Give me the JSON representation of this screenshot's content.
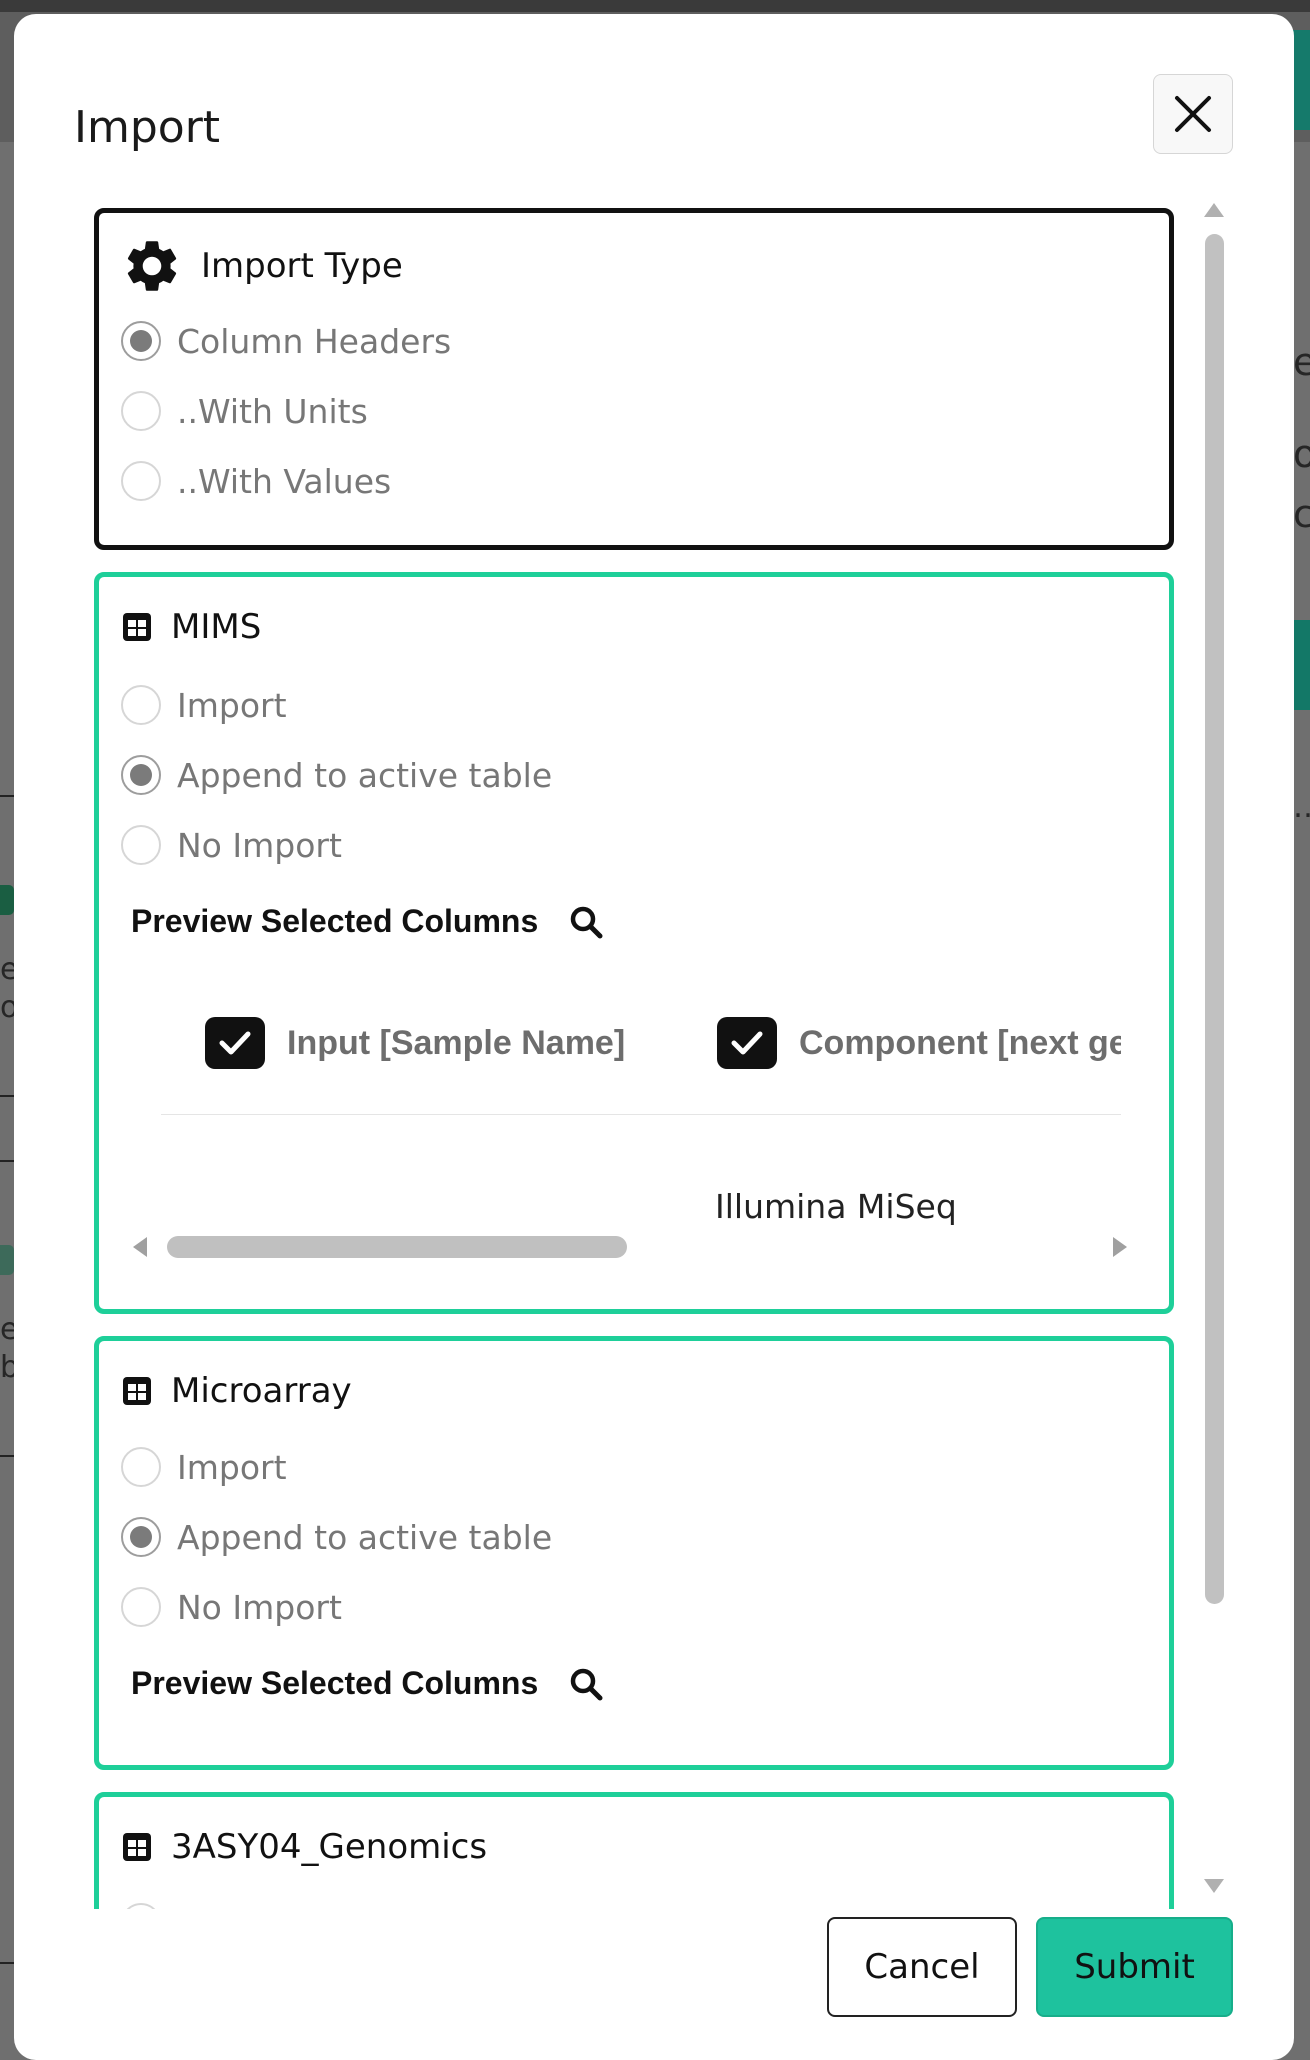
{
  "background": {
    "fragments": [
      "e",
      "o",
      "c",
      "…",
      "el",
      "o",
      "el",
      "b"
    ]
  },
  "modal": {
    "title": "Import",
    "close_icon": "close-icon",
    "import_type": {
      "title": "Import Type",
      "icon": "gear-icon",
      "options": [
        "Column Headers",
        "..With Units",
        "..With Values"
      ],
      "selected": "Column Headers"
    },
    "tables": [
      {
        "name": "MIMS",
        "icon": "table-icon",
        "options": [
          "Import",
          "Append to active table",
          "No Import"
        ],
        "selected": "Append to active table",
        "preview_label": "Preview Selected Columns",
        "preview": {
          "columns": [
            "Input [Sample Name]",
            "Component [next gen"
          ],
          "rows": [
            [
              "",
              "Illumina MiSeq"
            ]
          ]
        }
      },
      {
        "name": "Microarray",
        "icon": "table-icon",
        "options": [
          "Import",
          "Append to active table",
          "No Import"
        ],
        "selected": "Append to active table",
        "preview_label": "Preview Selected Columns"
      },
      {
        "name": "3ASY04_Genomics",
        "icon": "table-icon"
      }
    ],
    "footer": {
      "cancel_label": "Cancel",
      "submit_label": "Submit",
      "submit_color": "#1ec29e"
    }
  }
}
